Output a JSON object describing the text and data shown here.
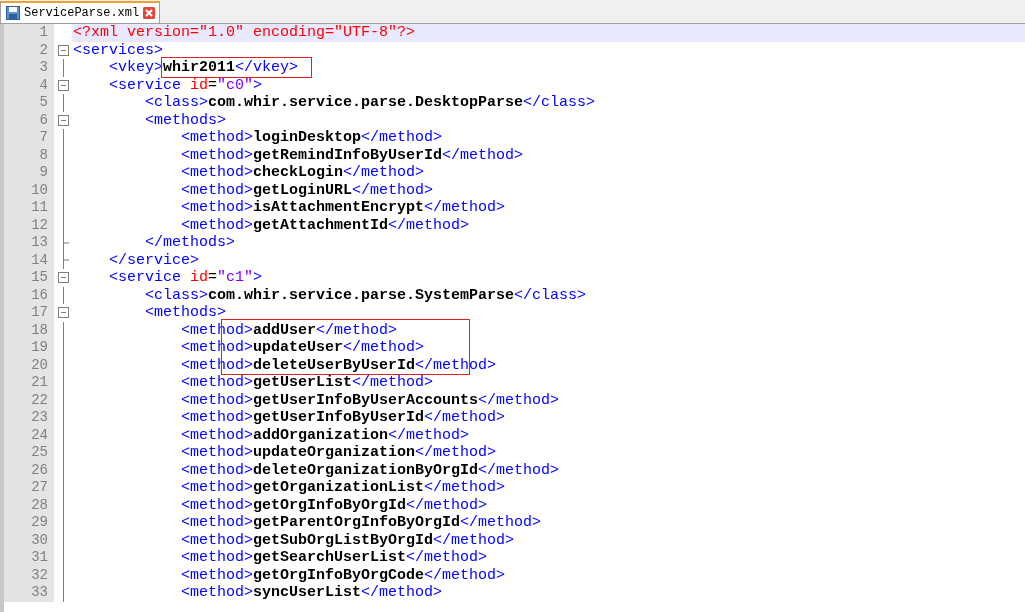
{
  "tab": {
    "label": "ServiceParse.xml",
    "selected": true
  },
  "lines": [
    {
      "number": "1",
      "current": true,
      "kind": "plain",
      "framed": false,
      "tokens": [
        {
          "kind": "decl",
          "text": "<?xml version=\"1.0\" encoding=\"UTF-8\"?>"
        }
      ]
    },
    {
      "number": "2",
      "current": false,
      "kind": "fold-start",
      "framed": false,
      "tokens": [
        {
          "kind": "tag",
          "text": "<services>"
        }
      ],
      "children": [
        {
          "number": "3",
          "current": false,
          "kind": "fold-body",
          "framed": true,
          "tokens": [
            {
              "kind": "tag",
              "text": "<vkey>"
            },
            {
              "kind": "value",
              "text": "whir2011"
            },
            {
              "kind": "tag",
              "text": "</vkey>"
            }
          ]
        },
        {
          "number": "4",
          "current": false,
          "kind": "fold-start",
          "framed": false,
          "tokens": [
            {
              "kind": "tag",
              "text": "<service"
            },
            {
              "kind": "attr",
              "text": " id"
            },
            {
              "kind": "punct",
              "text": "="
            },
            {
              "kind": "string",
              "text": "\"c0\""
            },
            {
              "kind": "tag",
              "text": ">"
            }
          ],
          "children": [
            {
              "number": "5",
              "current": false,
              "kind": "fold-body",
              "framed": false,
              "tokens": [
                {
                  "kind": "tag",
                  "text": "<class>"
                },
                {
                  "kind": "value",
                  "text": "com.whir.service.parse.DesktopParse"
                },
                {
                  "kind": "tag",
                  "text": "</class>"
                }
              ]
            },
            {
              "number": "6",
              "current": false,
              "kind": "fold-start",
              "framed": false,
              "tokens": [
                {
                  "kind": "tag",
                  "text": "<methods>"
                }
              ],
              "children": [
                {
                  "number": "7",
                  "current": false,
                  "kind": "fold-body",
                  "framed": false,
                  "tokens": [
                    {
                      "kind": "tag",
                      "text": "<method>"
                    },
                    {
                      "kind": "value",
                      "text": "loginDesktop"
                    },
                    {
                      "kind": "tag",
                      "text": "</method>"
                    }
                  ]
                },
                {
                  "number": "8",
                  "current": false,
                  "kind": "fold-body",
                  "framed": false,
                  "tokens": [
                    {
                      "kind": "tag",
                      "text": "<method>"
                    },
                    {
                      "kind": "value",
                      "text": "getRemindInfoByUserId"
                    },
                    {
                      "kind": "tag",
                      "text": "</method>"
                    }
                  ]
                },
                {
                  "number": "9",
                  "current": false,
                  "kind": "fold-body",
                  "framed": false,
                  "tokens": [
                    {
                      "kind": "tag",
                      "text": "<method>"
                    },
                    {
                      "kind": "value",
                      "text": "checkLogin"
                    },
                    {
                      "kind": "tag",
                      "text": "</method>"
                    }
                  ]
                },
                {
                  "number": "10",
                  "current": false,
                  "kind": "fold-body",
                  "framed": false,
                  "tokens": [
                    {
                      "kind": "tag",
                      "text": "<method>"
                    },
                    {
                      "kind": "value",
                      "text": "getLoginURL"
                    },
                    {
                      "kind": "tag",
                      "text": "</method>"
                    }
                  ]
                },
                {
                  "number": "11",
                  "current": false,
                  "kind": "fold-body",
                  "framed": false,
                  "tokens": [
                    {
                      "kind": "tag",
                      "text": "<method>"
                    },
                    {
                      "kind": "value",
                      "text": "isAttachmentEncrypt"
                    },
                    {
                      "kind": "tag",
                      "text": "</method>"
                    }
                  ]
                },
                {
                  "number": "12",
                  "current": false,
                  "kind": "fold-body",
                  "framed": false,
                  "tokens": [
                    {
                      "kind": "tag",
                      "text": "<method>"
                    },
                    {
                      "kind": "value",
                      "text": "getAttachmentId"
                    },
                    {
                      "kind": "tag",
                      "text": "</method>"
                    }
                  ]
                }
              ]
            },
            {
              "number": "13",
              "current": false,
              "kind": "fold-end",
              "framed": false,
              "tokens": [
                {
                  "kind": "tag",
                  "text": "</methods>"
                }
              ]
            }
          ]
        },
        {
          "number": "14",
          "current": false,
          "kind": "fold-end",
          "framed": false,
          "tokens": [
            {
              "kind": "tag",
              "text": "</service>"
            }
          ]
        },
        {
          "number": "15",
          "current": false,
          "kind": "fold-start",
          "framed": false,
          "tokens": [
            {
              "kind": "tag",
              "text": "<service"
            },
            {
              "kind": "attr",
              "text": " id"
            },
            {
              "kind": "punct",
              "text": "="
            },
            {
              "kind": "string",
              "text": "\"c1\""
            },
            {
              "kind": "tag",
              "text": ">"
            }
          ],
          "children": [
            {
              "number": "16",
              "current": false,
              "kind": "fold-body",
              "framed": false,
              "tokens": [
                {
                  "kind": "tag",
                  "text": "<class>"
                },
                {
                  "kind": "value",
                  "text": "com.whir.service.parse.SystemParse"
                },
                {
                  "kind": "tag",
                  "text": "</class>"
                }
              ]
            },
            {
              "number": "17",
              "current": false,
              "kind": "fold-start",
              "framed": false,
              "tokens": [
                {
                  "kind": "tag",
                  "text": "<methods>"
                }
              ],
              "children": [
                {
                  "number": "18",
                  "current": false,
                  "kind": "fold-body",
                  "framed": true,
                  "tokens": [
                    {
                      "kind": "tag",
                      "text": "<method>"
                    },
                    {
                      "kind": "value",
                      "text": "addUser"
                    },
                    {
                      "kind": "tag",
                      "text": "</method>"
                    }
                  ]
                },
                {
                  "number": "19",
                  "current": false,
                  "kind": "fold-body",
                  "framed": true,
                  "tokens": [
                    {
                      "kind": "tag",
                      "text": "<method>"
                    },
                    {
                      "kind": "value",
                      "text": "updateUser"
                    },
                    {
                      "kind": "tag",
                      "text": "</method>"
                    }
                  ]
                },
                {
                  "number": "20",
                  "current": false,
                  "kind": "fold-body",
                  "framed": true,
                  "tokens": [
                    {
                      "kind": "tag",
                      "text": "<method>"
                    },
                    {
                      "kind": "value",
                      "text": "deleteUserByUserId"
                    },
                    {
                      "kind": "tag",
                      "text": "</method>"
                    }
                  ]
                },
                {
                  "number": "21",
                  "current": false,
                  "kind": "fold-body",
                  "framed": false,
                  "tokens": [
                    {
                      "kind": "tag",
                      "text": "<method>"
                    },
                    {
                      "kind": "value",
                      "text": "getUserList"
                    },
                    {
                      "kind": "tag",
                      "text": "</method>"
                    }
                  ]
                },
                {
                  "number": "22",
                  "current": false,
                  "kind": "fold-body",
                  "framed": false,
                  "tokens": [
                    {
                      "kind": "tag",
                      "text": "<method>"
                    },
                    {
                      "kind": "value",
                      "text": "getUserInfoByUserAccounts"
                    },
                    {
                      "kind": "tag",
                      "text": "</method>"
                    }
                  ]
                },
                {
                  "number": "23",
                  "current": false,
                  "kind": "fold-body",
                  "framed": false,
                  "tokens": [
                    {
                      "kind": "tag",
                      "text": "<method>"
                    },
                    {
                      "kind": "value",
                      "text": "getUserInfoByUserId"
                    },
                    {
                      "kind": "tag",
                      "text": "</method>"
                    }
                  ]
                },
                {
                  "number": "24",
                  "current": false,
                  "kind": "fold-body",
                  "framed": false,
                  "tokens": [
                    {
                      "kind": "tag",
                      "text": "<method>"
                    },
                    {
                      "kind": "value",
                      "text": "addOrganization"
                    },
                    {
                      "kind": "tag",
                      "text": "</method>"
                    }
                  ]
                },
                {
                  "number": "25",
                  "current": false,
                  "kind": "fold-body",
                  "framed": false,
                  "tokens": [
                    {
                      "kind": "tag",
                      "text": "<method>"
                    },
                    {
                      "kind": "value",
                      "text": "updateOrganization"
                    },
                    {
                      "kind": "tag",
                      "text": "</method>"
                    }
                  ]
                },
                {
                  "number": "26",
                  "current": false,
                  "kind": "fold-body",
                  "framed": false,
                  "tokens": [
                    {
                      "kind": "tag",
                      "text": "<method>"
                    },
                    {
                      "kind": "value",
                      "text": "deleteOrganizationByOrgId"
                    },
                    {
                      "kind": "tag",
                      "text": "</method>"
                    }
                  ]
                },
                {
                  "number": "27",
                  "current": false,
                  "kind": "fold-body",
                  "framed": false,
                  "tokens": [
                    {
                      "kind": "tag",
                      "text": "<method>"
                    },
                    {
                      "kind": "value",
                      "text": "getOrganizationList"
                    },
                    {
                      "kind": "tag",
                      "text": "</method>"
                    }
                  ]
                },
                {
                  "number": "28",
                  "current": false,
                  "kind": "fold-body",
                  "framed": false,
                  "tokens": [
                    {
                      "kind": "tag",
                      "text": "<method>"
                    },
                    {
                      "kind": "value",
                      "text": "getOrgInfoByOrgId"
                    },
                    {
                      "kind": "tag",
                      "text": "</method>"
                    }
                  ]
                },
                {
                  "number": "29",
                  "current": false,
                  "kind": "fold-body",
                  "framed": false,
                  "tokens": [
                    {
                      "kind": "tag",
                      "text": "<method>"
                    },
                    {
                      "kind": "value",
                      "text": "getParentOrgInfoByOrgId"
                    },
                    {
                      "kind": "tag",
                      "text": "</method>"
                    }
                  ]
                },
                {
                  "number": "30",
                  "current": false,
                  "kind": "fold-body",
                  "framed": false,
                  "tokens": [
                    {
                      "kind": "tag",
                      "text": "<method>"
                    },
                    {
                      "kind": "value",
                      "text": "getSubOrgListByOrgId"
                    },
                    {
                      "kind": "tag",
                      "text": "</method>"
                    }
                  ]
                },
                {
                  "number": "31",
                  "current": false,
                  "kind": "fold-body",
                  "framed": false,
                  "tokens": [
                    {
                      "kind": "tag",
                      "text": "<method>"
                    },
                    {
                      "kind": "value",
                      "text": "getSearchUserList"
                    },
                    {
                      "kind": "tag",
                      "text": "</method>"
                    }
                  ]
                },
                {
                  "number": "32",
                  "current": false,
                  "kind": "fold-body",
                  "framed": false,
                  "tokens": [
                    {
                      "kind": "tag",
                      "text": "<method>"
                    },
                    {
                      "kind": "value",
                      "text": "getOrgInfoByOrgCode"
                    },
                    {
                      "kind": "tag",
                      "text": "</method>"
                    }
                  ]
                },
                {
                  "number": "33",
                  "current": false,
                  "kind": "fold-body",
                  "framed": false,
                  "tokens": [
                    {
                      "kind": "tag",
                      "text": "<method>"
                    },
                    {
                      "kind": "value",
                      "text": "syncUserList"
                    },
                    {
                      "kind": "tag",
                      "text": "</method>"
                    }
                  ]
                }
              ]
            }
          ]
        }
      ]
    }
  ]
}
